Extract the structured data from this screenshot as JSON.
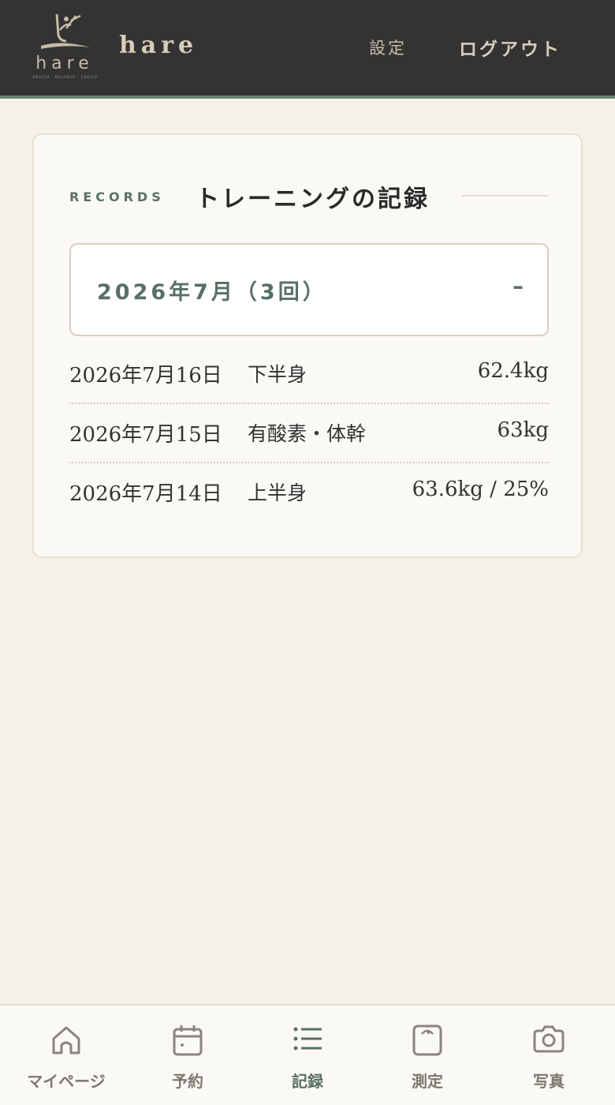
{
  "header": {
    "logo_text": "hare",
    "logo_tagline": "HEALTH · BALANCE · CHOICE",
    "brand": "hare",
    "settings_label": "設定",
    "logout_label": "ログアウト"
  },
  "records": {
    "section_label": "RECORDS",
    "title": "トレーニングの記録",
    "group": {
      "title": "2026年7月（3回）",
      "toggle": "–",
      "expanded": true
    },
    "items": [
      {
        "date": "2026年7月16日",
        "type": "下半身",
        "value": "62.4kg"
      },
      {
        "date": "2026年7月15日",
        "type": "有酸素・体幹",
        "value": "63kg"
      },
      {
        "date": "2026年7月14日",
        "type": "上半身",
        "value": "63.6kg / 25%"
      }
    ]
  },
  "tabbar": {
    "active": "記録",
    "items": [
      {
        "label": "マイページ",
        "icon": "home-icon"
      },
      {
        "label": "予約",
        "icon": "calendar-icon"
      },
      {
        "label": "記録",
        "icon": "list-icon"
      },
      {
        "label": "測定",
        "icon": "scale-icon"
      },
      {
        "label": "写真",
        "icon": "camera-icon"
      }
    ]
  },
  "colors": {
    "header_bg": "#333333",
    "accent_green": "#587063",
    "page_bg": "#f4f0ea",
    "card_bg": "#fbf9f5"
  }
}
